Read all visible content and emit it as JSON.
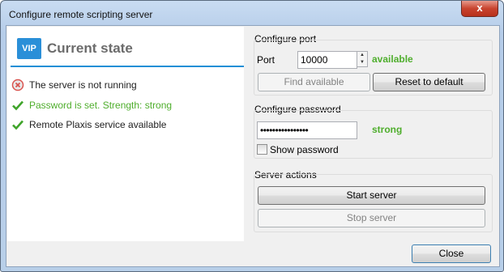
{
  "window": {
    "title": "Configure remote scripting server",
    "close_glyph": "x"
  },
  "left": {
    "logo_text": "VIP",
    "header": "Current state",
    "statuses": [
      {
        "icon": "error-icon",
        "text": "The server is not running",
        "color": "#222222"
      },
      {
        "icon": "checkmark-icon",
        "text": "Password is set. Strength: strong",
        "color": "#4fae2d"
      },
      {
        "icon": "checkmark-icon",
        "text": "Remote Plaxis service available",
        "color": "#222222"
      }
    ]
  },
  "port": {
    "group_label": "Configure port",
    "label": "Port",
    "value": "10000",
    "status": "available",
    "find_available": "Find available",
    "reset_default": "Reset to default"
  },
  "password": {
    "group_label": "Configure password",
    "value": "••••••••••••••••",
    "strength": "strong",
    "show_label": "Show password",
    "show_checked": false
  },
  "server": {
    "group_label": "Server actions",
    "start": "Start server",
    "stop": "Stop server"
  },
  "footer": {
    "close": "Close"
  },
  "colors": {
    "accent": "#1e8fd6",
    "success": "#4fae2d",
    "error": "#d9534f"
  }
}
